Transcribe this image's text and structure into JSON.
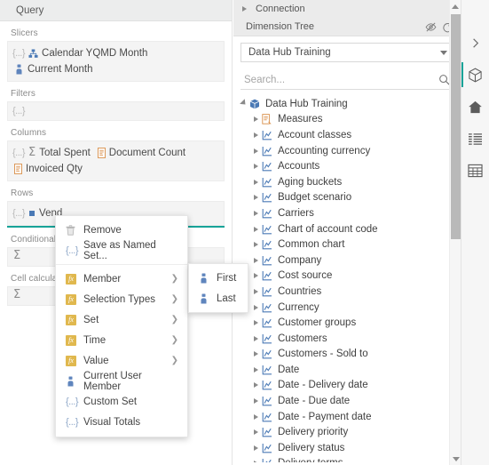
{
  "query_panel": {
    "header_title": "Query",
    "sections": [
      {
        "label": "Slicers",
        "rows": [
          {
            "braces": "{...}",
            "items": [
              {
                "icon": "hierarchy-icon",
                "label": "Calendar YQMD Month"
              }
            ]
          },
          {
            "braces": "",
            "items": [
              {
                "icon": "user-member-icon",
                "label": "Current Month"
              }
            ]
          }
        ]
      },
      {
        "label": "Filters",
        "rows": [
          {
            "braces": "{...}",
            "items": []
          }
        ]
      },
      {
        "label": "Columns",
        "rows": [
          {
            "braces": "{...}",
            "items": [
              {
                "icon": "sigma-icon",
                "label": "Total Spent"
              },
              {
                "icon": "measure-icon",
                "label": "Document Count"
              }
            ]
          },
          {
            "braces": "",
            "items": [
              {
                "icon": "measure-icon",
                "label": "Invoiced Qty"
              }
            ]
          }
        ]
      },
      {
        "label": "Rows",
        "rows": [
          {
            "braces": "{...}",
            "items": [
              {
                "icon": "square-icon",
                "label": "Vend"
              }
            ]
          }
        ]
      },
      {
        "label": "Conditional",
        "rows": [
          {
            "braces": "",
            "items": [
              {
                "icon": "sigma-icon",
                "label": ""
              }
            ]
          }
        ]
      },
      {
        "label": "Cell calculation",
        "rows": [
          {
            "braces": "",
            "items": [
              {
                "icon": "sigma-icon",
                "label": ""
              }
            ]
          }
        ]
      }
    ]
  },
  "context_menu": {
    "groups": [
      {
        "items": [
          {
            "label": "Remove",
            "icon": "trash-icon",
            "submenu": false
          },
          {
            "label": "Save as Named Set...",
            "icon": "braces-icon",
            "submenu": false
          }
        ]
      },
      {
        "items": [
          {
            "label": "Member",
            "icon": "fx-icon",
            "submenu": true
          },
          {
            "label": "Selection Types",
            "icon": "fx-icon",
            "submenu": true
          },
          {
            "label": "Set",
            "icon": "fx-icon",
            "submenu": true
          },
          {
            "label": "Time",
            "icon": "fx-icon",
            "submenu": true
          },
          {
            "label": "Value",
            "icon": "fx-icon",
            "submenu": true
          },
          {
            "label": "Current User Member",
            "icon": "user-member-icon",
            "submenu": false
          },
          {
            "label": "Custom Set",
            "icon": "braces-icon",
            "submenu": false
          },
          {
            "label": "Visual Totals",
            "icon": "braces-icon",
            "submenu": false
          }
        ]
      }
    ],
    "submenu": {
      "items": [
        {
          "label": "First",
          "icon": "user-member-icon"
        },
        {
          "label": "Last",
          "icon": "user-member-icon"
        }
      ]
    }
  },
  "dimension_panel": {
    "connection_label": "Connection",
    "dimension_tree_label": "Dimension Tree",
    "header_icons": [
      "eye-off-icon",
      "refresh-icon"
    ],
    "cube_select": {
      "value": "Data Hub Training"
    },
    "search": {
      "value": "",
      "placeholder": "Search..."
    },
    "tree": {
      "root": {
        "label": "Data Hub Training",
        "icon": "cube-icon",
        "expanded": true
      },
      "nodes": [
        {
          "label": "Measures",
          "icon": "measures-icon"
        },
        {
          "label": "Account classes",
          "icon": "dimension-icon"
        },
        {
          "label": "Accounting currency",
          "icon": "dimension-icon"
        },
        {
          "label": "Accounts",
          "icon": "dimension-icon"
        },
        {
          "label": "Aging buckets",
          "icon": "dimension-icon"
        },
        {
          "label": "Budget scenario",
          "icon": "dimension-icon"
        },
        {
          "label": "Carriers",
          "icon": "dimension-icon"
        },
        {
          "label": "Chart of account code",
          "icon": "dimension-icon"
        },
        {
          "label": "Common chart",
          "icon": "dimension-icon"
        },
        {
          "label": "Company",
          "icon": "dimension-icon"
        },
        {
          "label": "Cost source",
          "icon": "dimension-icon"
        },
        {
          "label": "Countries",
          "icon": "dimension-icon"
        },
        {
          "label": "Currency",
          "icon": "dimension-icon"
        },
        {
          "label": "Customer groups",
          "icon": "dimension-icon"
        },
        {
          "label": "Customers",
          "icon": "dimension-icon"
        },
        {
          "label": "Customers - Sold to",
          "icon": "dimension-icon"
        },
        {
          "label": "Date",
          "icon": "dimension-icon"
        },
        {
          "label": "Date - Delivery date",
          "icon": "dimension-icon"
        },
        {
          "label": "Date - Due date",
          "icon": "dimension-icon"
        },
        {
          "label": "Date - Payment date",
          "icon": "dimension-icon"
        },
        {
          "label": "Delivery priority",
          "icon": "dimension-icon"
        },
        {
          "label": "Delivery status",
          "icon": "dimension-icon"
        },
        {
          "label": "Delivery terms",
          "icon": "dimension-icon"
        }
      ]
    }
  },
  "rail": {
    "items": [
      {
        "name": "expand-panel-icon",
        "glyph": "chevron-right-icon",
        "active": false
      },
      {
        "name": "cube-icon",
        "glyph": "cube-icon",
        "active": true
      },
      {
        "name": "home-icon",
        "glyph": "home-icon",
        "active": false
      },
      {
        "name": "list-icon",
        "glyph": "list-icon",
        "active": false
      },
      {
        "name": "grid-icon",
        "glyph": "grid-icon",
        "active": false
      }
    ]
  },
  "colors": {
    "accent": "#17a398",
    "panel_header_bg": "#eceded",
    "drop_zone_bg": "#f4f4f4",
    "fx_gold": "#e0b84e",
    "dimension_blue": "#4a79b5",
    "measure_orange": "#d98f4a"
  }
}
